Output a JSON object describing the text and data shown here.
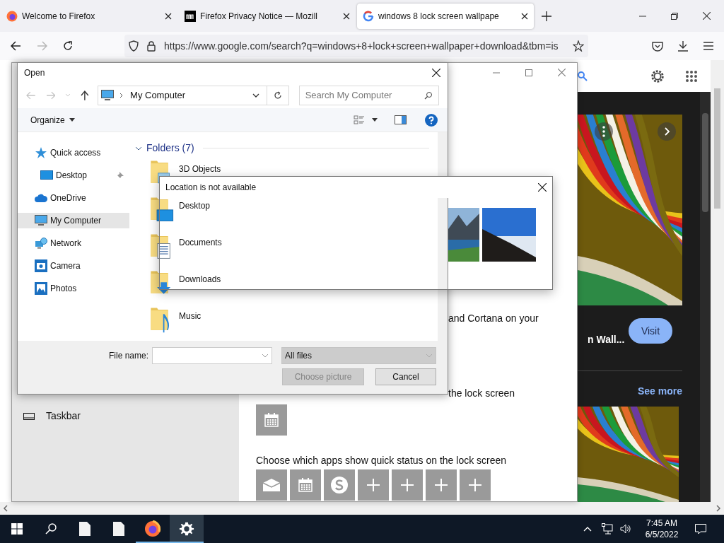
{
  "browser": {
    "tabs": [
      {
        "title": "Welcome to Firefox",
        "selected": false,
        "kind": "firefox"
      },
      {
        "title": "Firefox Privacy Notice — Mozill",
        "selected": false,
        "kind": "mozilla"
      },
      {
        "title": "windows 8 lock screen wallpape",
        "selected": true,
        "kind": "google"
      }
    ],
    "forward_disabled": true,
    "url": "https://www.google.com/search?q=windows+8+lock+screen+wallpaper+download&tbm=is"
  },
  "settings_window": {
    "sidebar_items": [
      {
        "label": "Taskbar"
      }
    ],
    "partial_text": "and Cortana on your",
    "lock_screen_text": "the lock screen",
    "lock_screen_tiles": [
      {
        "kind": "calendar"
      }
    ],
    "quick_status_text": "Choose which apps show quick status on the lock screen",
    "quick_status_tiles": [
      {
        "kind": "mail"
      },
      {
        "kind": "calendar"
      },
      {
        "kind": "skype"
      },
      {
        "kind": "add"
      },
      {
        "kind": "add"
      },
      {
        "kind": "add"
      },
      {
        "kind": "add"
      }
    ]
  },
  "image_results": {
    "title": "n Wall...",
    "visit_button": "Visit",
    "see_more": "See more"
  },
  "open_dialog": {
    "title": "Open",
    "address": "My Computer",
    "search_placeholder": "Search My Computer",
    "organize": "Organize",
    "back_disabled": true,
    "forward_disabled": true,
    "nav_items": [
      {
        "label": "Quick access",
        "kind": "star",
        "selected": false,
        "children": [
          {
            "label": "Desktop",
            "kind": "desktop",
            "selected": false,
            "pinned": true
          }
        ]
      },
      {
        "label": "OneDrive",
        "kind": "cloud",
        "selected": false
      },
      {
        "label": "My Computer",
        "kind": "computer",
        "selected": true
      },
      {
        "label": "Network",
        "kind": "network",
        "selected": false
      },
      {
        "label": "Camera",
        "kind": "camera",
        "selected": false
      },
      {
        "label": "Photos",
        "kind": "photos",
        "selected": false
      }
    ],
    "section_title": "Folders (7)",
    "folders": [
      {
        "name": "3D Objects",
        "kind": "objects"
      },
      {
        "name": "Desktop",
        "kind": "desktop"
      },
      {
        "name": "Documents",
        "kind": "documents"
      },
      {
        "name": "Downloads",
        "kind": "downloads"
      },
      {
        "name": "Music",
        "kind": "music"
      }
    ],
    "file_name_label": "File name:",
    "filter": {
      "value": "All files",
      "disabled": true
    },
    "buttons": [
      {
        "label": "Choose picture",
        "disabled": true
      },
      {
        "label": "Cancel",
        "disabled": false
      }
    ]
  },
  "location_dialog": {
    "title": "Location is not available"
  },
  "taskbar": {
    "apps": [
      {
        "kind": "file",
        "open": false,
        "selected": false
      },
      {
        "kind": "file",
        "open": false,
        "selected": false
      },
      {
        "kind": "firefox",
        "open": true,
        "selected": false
      },
      {
        "kind": "settings",
        "open": true,
        "selected": true
      }
    ],
    "clock": {
      "time": "7:45 AM",
      "date": "6/5/2022"
    }
  }
}
